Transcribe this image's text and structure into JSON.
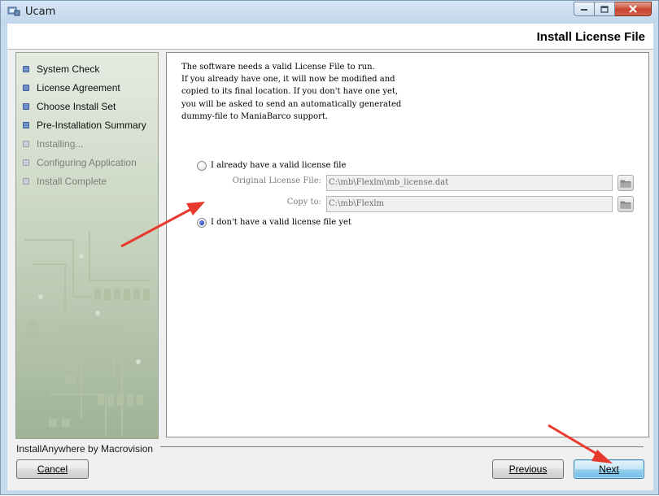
{
  "window": {
    "title": "Ucam",
    "controls": {
      "minimize": "–",
      "maximize": "□",
      "close": "✕"
    }
  },
  "header": {
    "title": "Install License File"
  },
  "sidebar": {
    "steps": [
      {
        "label": "System Check",
        "state": "done"
      },
      {
        "label": "License Agreement",
        "state": "done"
      },
      {
        "label": "Choose Install Set",
        "state": "done"
      },
      {
        "label": "Pre-Installation Summary",
        "state": "done"
      },
      {
        "label": "Installing...",
        "state": "pending"
      },
      {
        "label": "Configuring Application",
        "state": "pending"
      },
      {
        "label": "Install Complete",
        "state": "pending"
      }
    ]
  },
  "content": {
    "intro_lines": [
      "The software needs a valid License File to run.",
      "If you already have one, it will now be modified and",
      "copied to its final location. If you don't have one yet,",
      "you will be asked to send an automatically generated",
      "dummy-file to ManiaBarco support."
    ],
    "option_have": {
      "label": "I already have a valid license file",
      "selected": false
    },
    "original_license": {
      "label": "Original License File:",
      "value": "C:\\mb\\Flexlm\\mb_license.dat"
    },
    "copy_to": {
      "label": "Copy to:",
      "value": "C:\\mb\\Flexlm"
    },
    "option_dont_have": {
      "label": "I don't have a valid license file yet",
      "selected": true
    }
  },
  "footer": {
    "brand": "InstallAnywhere by Macrovision",
    "cancel_label": "Cancel",
    "previous_label": "Previous",
    "next_label": "Next"
  },
  "colors": {
    "annotation_arrow": "#e8392f",
    "step_done": "#6f8fc7",
    "step_pending": "#c9ced5"
  }
}
